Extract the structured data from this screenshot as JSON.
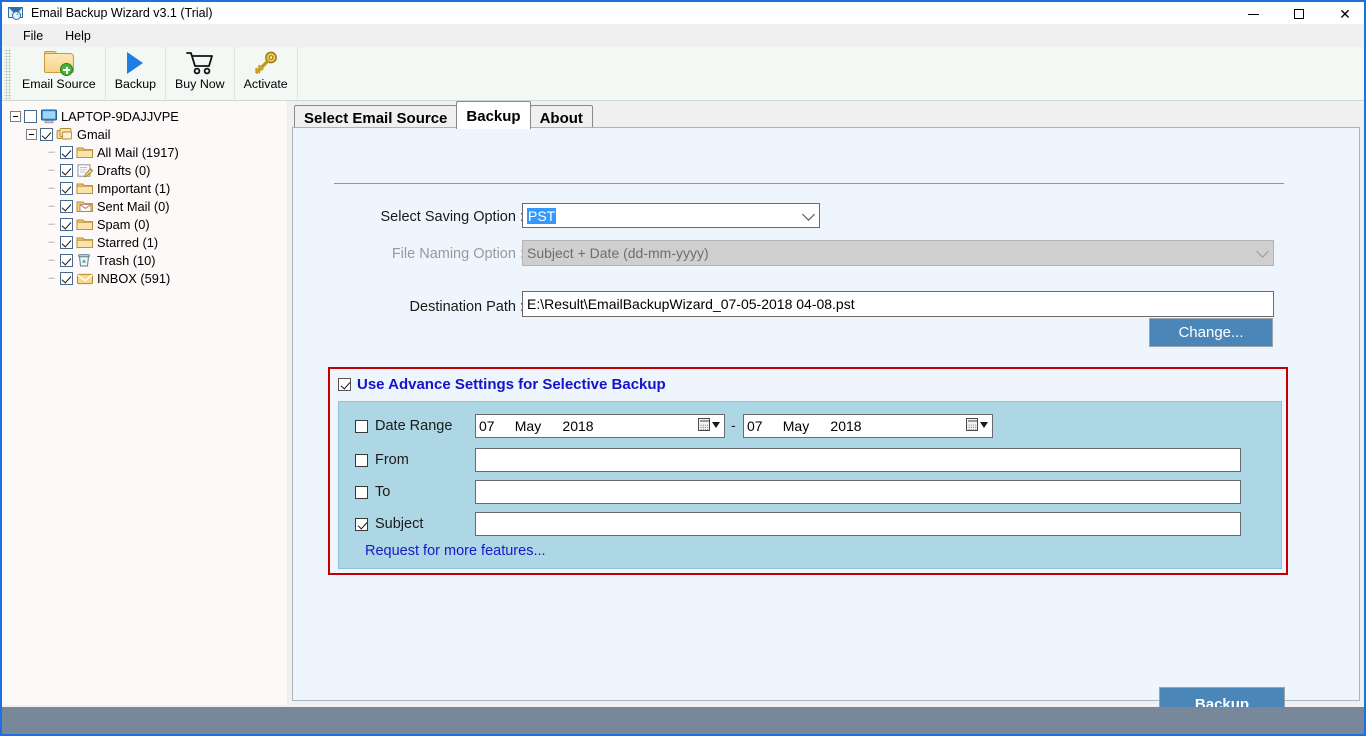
{
  "window": {
    "title": "Email Backup Wizard v3.1 (Trial)",
    "icon": "mail-download-icon",
    "controls": {
      "minimize": "minimize-icon",
      "maximize": "maximize-icon",
      "close": "close-icon"
    }
  },
  "menu": {
    "items": [
      "File",
      "Help"
    ]
  },
  "toolbar": {
    "buttons": [
      {
        "label": "Email Source",
        "icon": "folder-add-icon"
      },
      {
        "label": "Backup",
        "icon": "play-icon"
      },
      {
        "label": "Buy Now",
        "icon": "cart-icon"
      },
      {
        "label": "Activate",
        "icon": "key-icon"
      }
    ]
  },
  "sidebar": {
    "root": {
      "label": "LAPTOP-9DAJJVPE",
      "icon": "computer-icon",
      "checked": false,
      "expanded": true
    },
    "account": {
      "label": "Gmail",
      "icon": "accounts-icon",
      "checked": true,
      "expanded": true
    },
    "folders": [
      {
        "label": "All Mail (1917)",
        "icon": "folder-icon",
        "checked": true
      },
      {
        "label": "Drafts (0)",
        "icon": "drafts-icon",
        "checked": true
      },
      {
        "label": "Important (1)",
        "icon": "folder-icon",
        "checked": true
      },
      {
        "label": "Sent Mail (0)",
        "icon": "sent-icon",
        "checked": true
      },
      {
        "label": "Spam (0)",
        "icon": "folder-icon",
        "checked": true
      },
      {
        "label": "Starred (1)",
        "icon": "folder-icon",
        "checked": true
      },
      {
        "label": "Trash (10)",
        "icon": "trash-icon",
        "checked": true
      },
      {
        "label": "INBOX (591)",
        "icon": "inbox-icon",
        "checked": true
      }
    ]
  },
  "tabs": [
    {
      "label": "Select Email Source",
      "active": false
    },
    {
      "label": "Backup",
      "active": true
    },
    {
      "label": "About",
      "active": false
    }
  ],
  "form": {
    "saving_option": {
      "label": "Select Saving Option :",
      "value": "PST",
      "selected": true
    },
    "file_naming_option": {
      "label": "File Naming Option :",
      "value": "Subject + Date (dd-mm-yyyy)",
      "disabled": true
    },
    "destination_path": {
      "label": "Destination Path :",
      "value": "E:\\Result\\EmailBackupWizard_07-05-2018 04-08.pst"
    },
    "change_button": "Change...",
    "backup_button": "Backup"
  },
  "advanced": {
    "title": "Use Advance Settings for Selective Backup",
    "enabled": true,
    "date_range": {
      "label": "Date Range",
      "checked": false,
      "from": {
        "day": "07",
        "month": "May",
        "year": "2018"
      },
      "to": {
        "day": "07",
        "month": "May",
        "year": "2018"
      },
      "separator": "-"
    },
    "from": {
      "label": "From",
      "checked": false,
      "value": ""
    },
    "to": {
      "label": "To",
      "checked": false,
      "value": ""
    },
    "subject": {
      "label": "Subject",
      "checked": true,
      "value": ""
    },
    "request_link": "Request for more features..."
  },
  "colors": {
    "accent": "#1f6fe0",
    "panel_bg": "#eef5fd",
    "advanced_bg": "#aed7e6",
    "advanced_border": "#c00000",
    "button_blue": "#4a86b8",
    "link": "#1818c8",
    "status_bar": "#78879a"
  }
}
